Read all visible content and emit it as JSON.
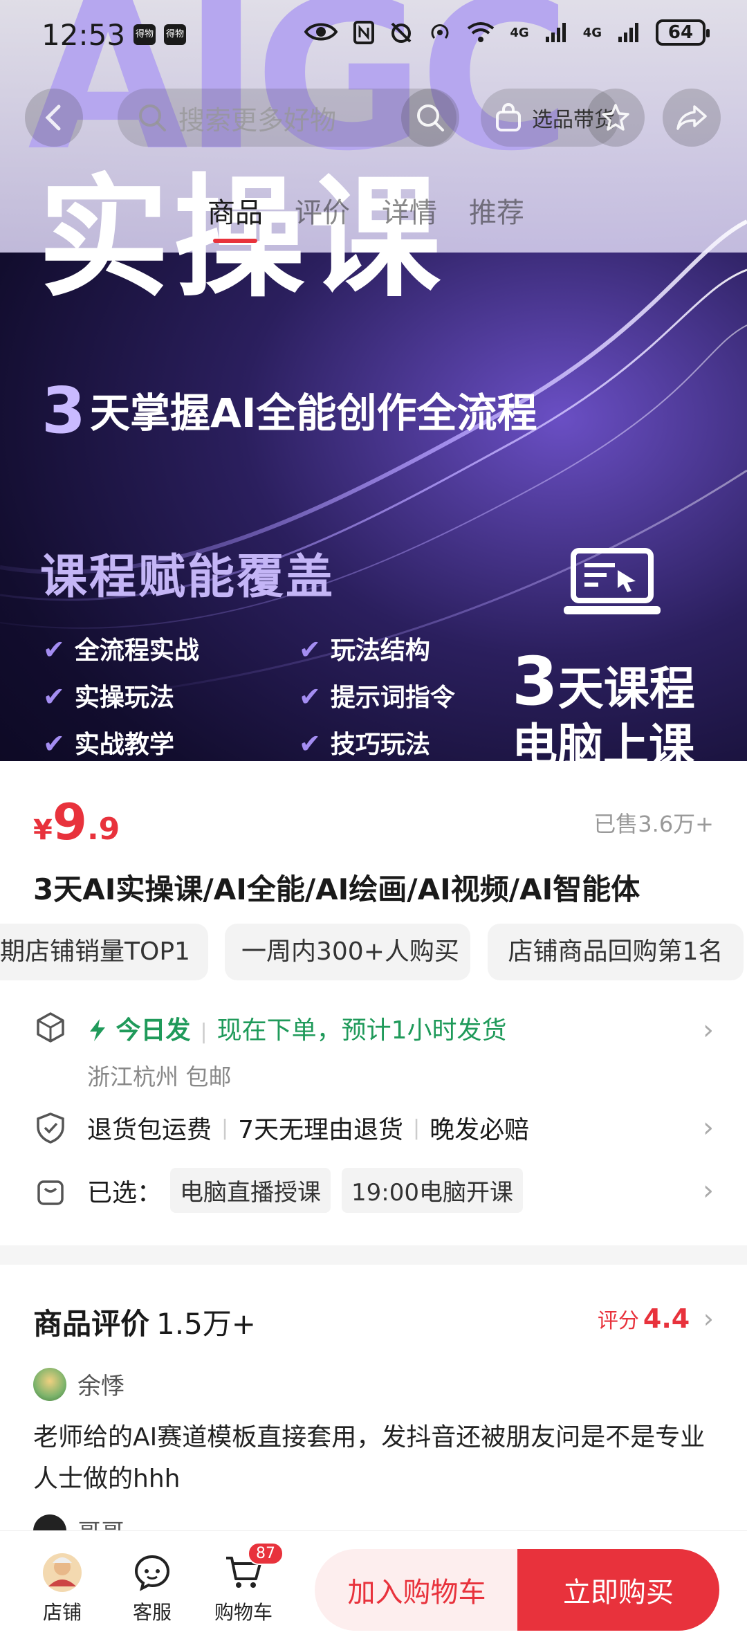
{
  "status_bar": {
    "time": "12:53",
    "app_badges": [
      "得物",
      "得物"
    ],
    "network": "4G",
    "network2": "4G",
    "battery": "64"
  },
  "nav": {
    "search_placeholder": "搜索更多好物",
    "select_label": "选品带货",
    "tabs": [
      {
        "label": "商品",
        "active": true
      },
      {
        "label": "评价",
        "active": false
      },
      {
        "label": "详情",
        "active": false
      },
      {
        "label": "推荐",
        "active": false
      }
    ]
  },
  "hero": {
    "brand_text": "AIGC",
    "title": "实操课",
    "subtitle_num": "3",
    "subtitle": "天掌握AI全能创作全流程",
    "cover_title": "课程赋能覆盖",
    "features_left": [
      "全流程实战",
      "实操玩法",
      "实战教学"
    ],
    "features_right": [
      "玩法结构",
      "提示词指令",
      "技巧玩法"
    ],
    "days_num": "3",
    "days_text": "天课程",
    "platform": "电脑上课"
  },
  "product": {
    "currency": "¥",
    "price_int": "9",
    "price_dec": ".9",
    "sold": "已售3.6万+",
    "title": "3天AI实操课/AI全能/AI绘画/AI视频/AI智能体",
    "chips": [
      "期店铺销量TOP1",
      "一周内300+人购买",
      "店铺商品回购第1名"
    ],
    "shipping": {
      "flash_label": "今日发",
      "detail": "现在下单，预计1小时发货",
      "location": "浙江杭州 包邮"
    },
    "guarantees": [
      "退货包运费",
      "7天无理由退货",
      "晚发必赔"
    ],
    "selected_label": "已选：",
    "selected_options": [
      "电脑直播授课",
      "19:00电脑开课"
    ]
  },
  "reviews": {
    "title": "商品评价",
    "count": "1.5万+",
    "score_label": "评分",
    "score": "4.4",
    "items": [
      {
        "user": "余悸",
        "text": "老师给的AI赛道模板直接套用，发抖音还被朋友问是不是专业人士做的hhh"
      },
      {
        "user": "哥哥"
      }
    ]
  },
  "bottom_bar": {
    "store_label": "店铺",
    "service_label": "客服",
    "cart_label": "购物车",
    "cart_count": "87",
    "add_cart": "加入购物车",
    "buy_now": "立即购买"
  },
  "colors": {
    "accent": "#e8323c",
    "green": "#1f9a5a"
  }
}
